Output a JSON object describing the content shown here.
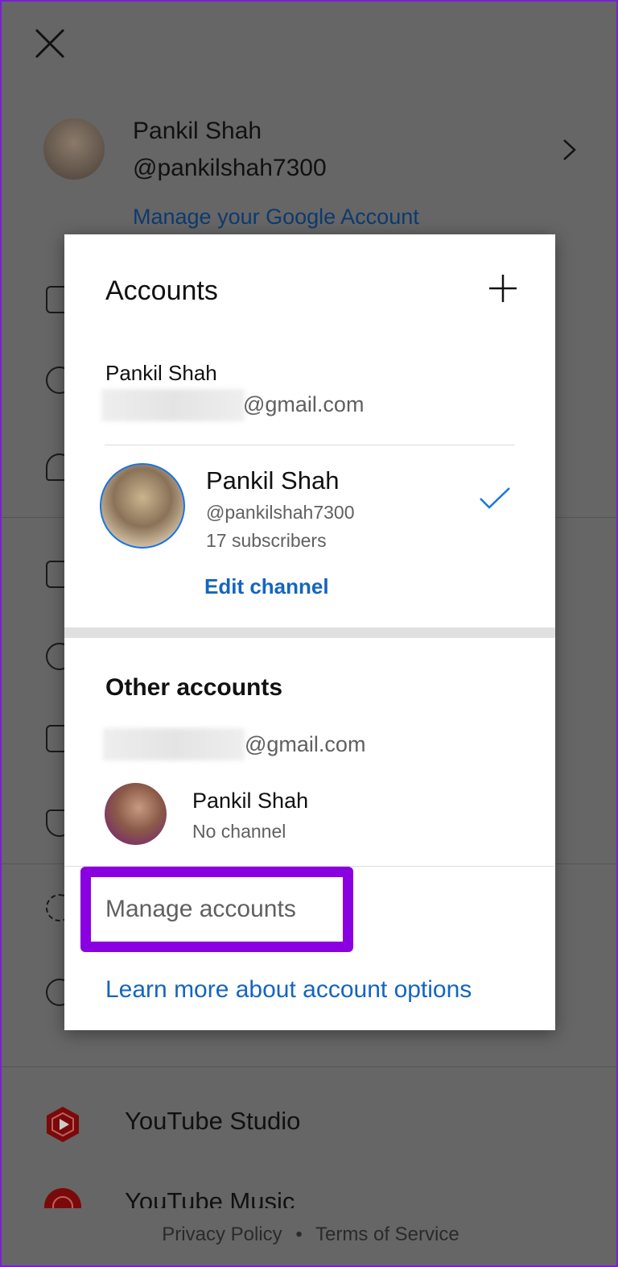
{
  "background": {
    "close_icon": "close-icon",
    "profile": {
      "name": "Pankil Shah",
      "handle": "@pankilshah7300",
      "manage_link": "Manage your Google Account"
    },
    "menu_items": [
      {
        "label": "YouTube Studio"
      },
      {
        "label": "YouTube Music"
      }
    ],
    "footer": {
      "privacy": "Privacy Policy",
      "separator": "•",
      "terms": "Terms of Service"
    }
  },
  "dialog": {
    "title": "Accounts",
    "add_icon": "plus-icon",
    "current_account": {
      "name": "Pankil Shah",
      "email": "@gmail.com"
    },
    "channel": {
      "name": "Pankil Shah",
      "handle": "@pankilshah7300",
      "subscribers": "17 subscribers",
      "edit_label": "Edit channel"
    },
    "other_heading": "Other accounts",
    "other_account": {
      "email": "@gmail.com",
      "name": "Pankil Shah",
      "status": "No channel"
    },
    "manage_label": "Manage accounts",
    "learn_more": "Learn more about account options"
  },
  "colors": {
    "accent_blue": "#1565c0",
    "highlight": "#8a00e0"
  }
}
